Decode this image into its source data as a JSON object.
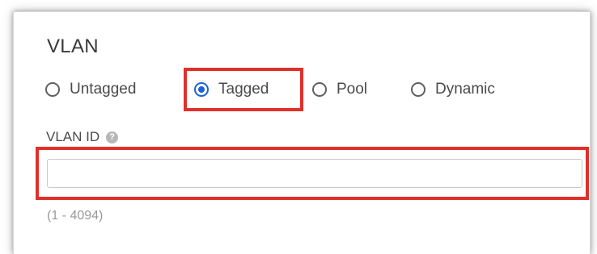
{
  "section": {
    "title": "VLAN"
  },
  "vlan_mode": {
    "selected": "Tagged",
    "options": [
      {
        "label": "Untagged",
        "checked": false
      },
      {
        "label": "Tagged",
        "checked": true
      },
      {
        "label": "Pool",
        "checked": false
      },
      {
        "label": "Dynamic",
        "checked": false
      }
    ]
  },
  "vlan_id": {
    "label": "VLAN ID",
    "help_icon": "question-mark-icon",
    "value": "",
    "placeholder": "",
    "range_hint": "(1 - 4094)"
  },
  "colors": {
    "accent": "#1a64d6",
    "highlight": "#e0302a",
    "text": "#4a4a4a",
    "hint": "#9a9a9a"
  }
}
